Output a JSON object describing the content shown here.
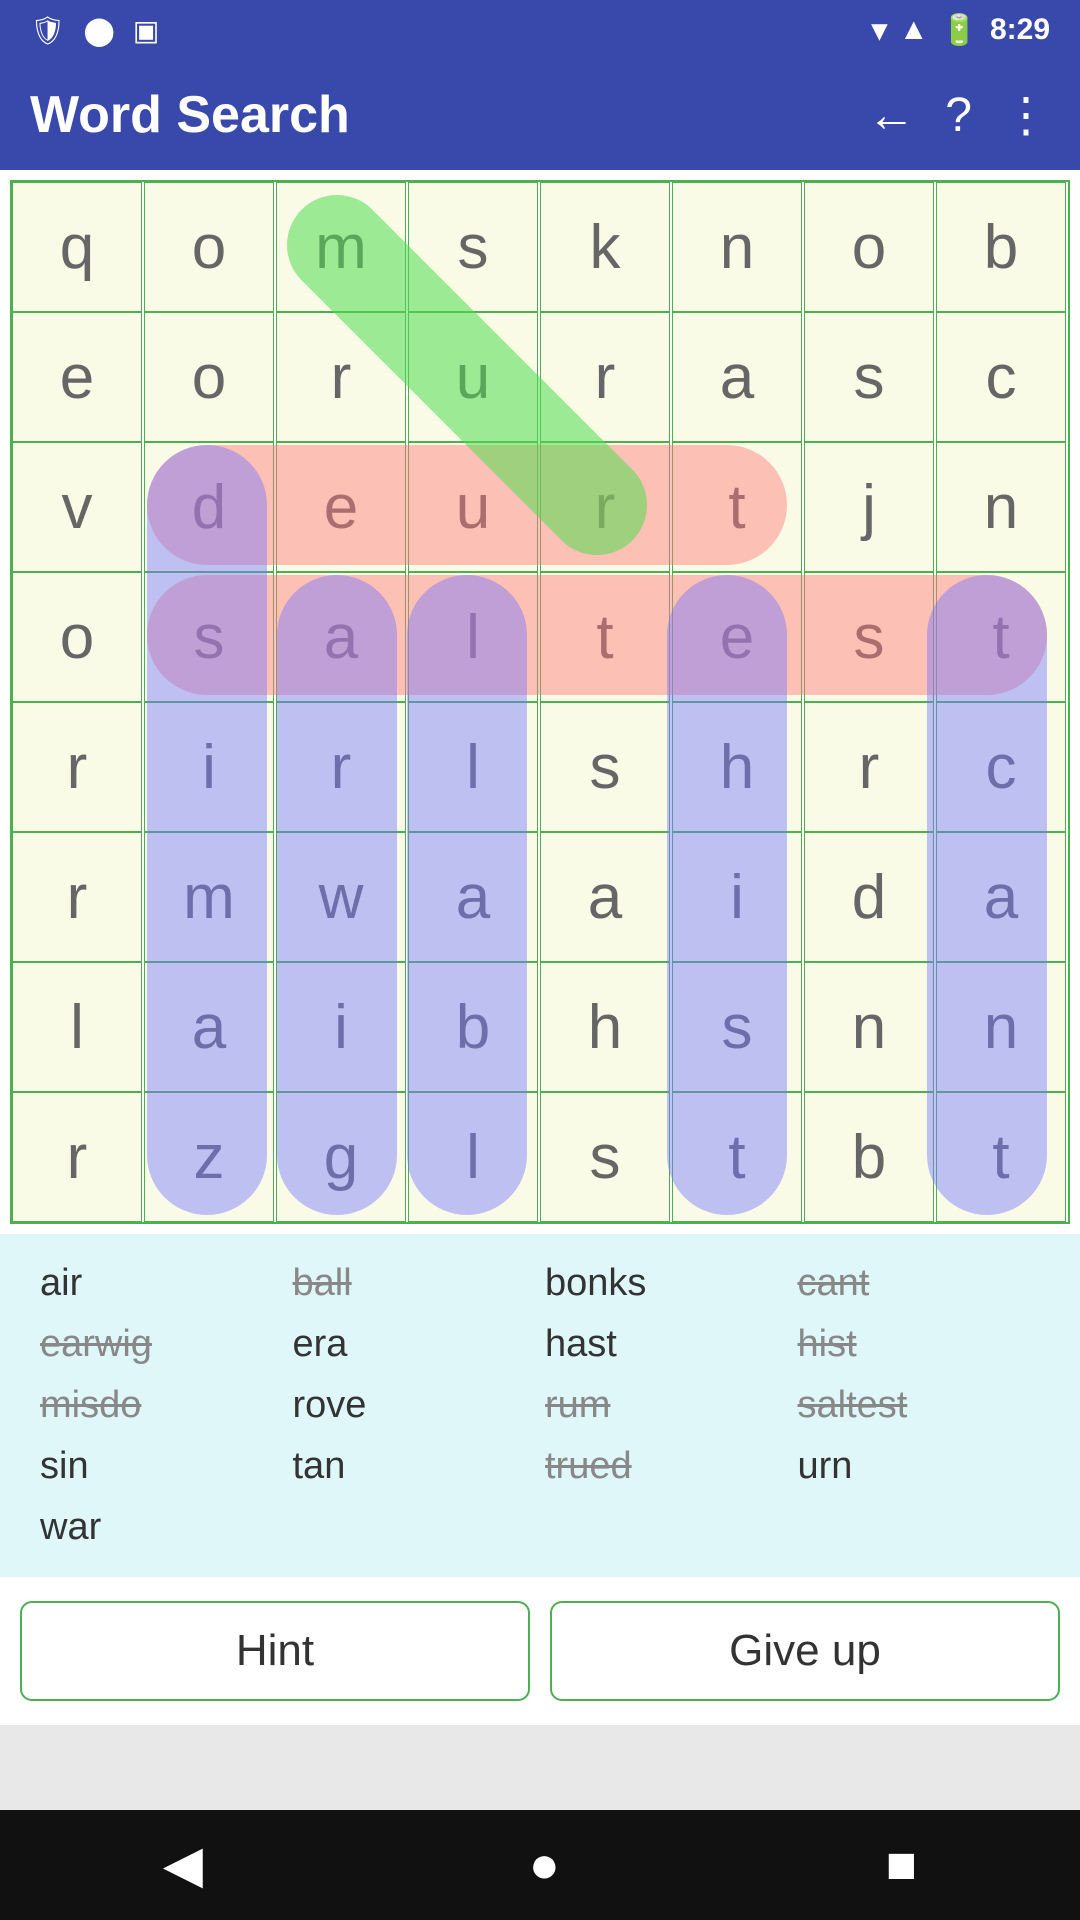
{
  "app": {
    "title": "Word Search",
    "status_time": "8:29"
  },
  "grid": {
    "cells": [
      [
        "q",
        "o",
        "m",
        "s",
        "k",
        "n",
        "o",
        "b"
      ],
      [
        "e",
        "o",
        "r",
        "u",
        "r",
        "a",
        "s",
        "c"
      ],
      [
        "v",
        "d",
        "e",
        "u",
        "r",
        "t",
        "j",
        "n"
      ],
      [
        "o",
        "s",
        "a",
        "l",
        "t",
        "e",
        "s",
        "t"
      ],
      [
        "r",
        "i",
        "r",
        "l",
        "s",
        "h",
        "r",
        "c"
      ],
      [
        "r",
        "m",
        "w",
        "a",
        "a",
        "i",
        "d",
        "a"
      ],
      [
        "l",
        "a",
        "i",
        "b",
        "h",
        "s",
        "n",
        "n"
      ],
      [
        "r",
        "z",
        "g",
        "l",
        "s",
        "t",
        "b",
        "t"
      ]
    ]
  },
  "words": [
    {
      "text": "air",
      "found": false
    },
    {
      "text": "ball",
      "found": true
    },
    {
      "text": "bonks",
      "found": false
    },
    {
      "text": "cant",
      "found": true
    },
    {
      "text": "earwig",
      "found": true
    },
    {
      "text": "era",
      "found": false
    },
    {
      "text": "hast",
      "found": false
    },
    {
      "text": "hist",
      "found": true
    },
    {
      "text": "misdo",
      "found": true
    },
    {
      "text": "rove",
      "found": false
    },
    {
      "text": "rum",
      "found": true
    },
    {
      "text": "saltest",
      "found": true
    },
    {
      "text": "sin",
      "found": false
    },
    {
      "text": "tan",
      "found": false
    },
    {
      "text": "trued",
      "found": true
    },
    {
      "text": "urn",
      "found": false
    },
    {
      "text": "war",
      "found": false
    }
  ],
  "buttons": {
    "hint": "Hint",
    "give_up": "Give up"
  },
  "nav": {
    "back": "◀",
    "home": "●",
    "recent": "■"
  }
}
